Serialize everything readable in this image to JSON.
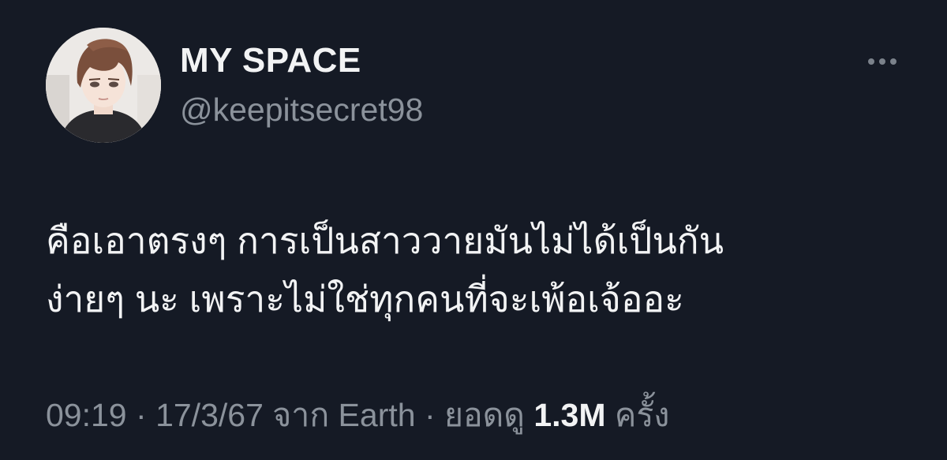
{
  "user": {
    "display_name": "MY SPACE",
    "handle": "@keepitsecret98",
    "avatar_icon": "anime-man-avatar"
  },
  "more_icon": "more-horizontal-icon",
  "tweet": {
    "lines": [
      "คือเอาตรงๆ การเป็นสาววายมันไม่ได้เป็นกัน",
      "ง่ายๆ นะ เพราะไม่ใช่ทุกคนที่จะเพ้อเจ้ออะ"
    ]
  },
  "meta": {
    "time": "09:19",
    "separator": "·",
    "date": "17/3/67",
    "source": "จาก Earth",
    "views_label": "ยอดดู",
    "views_count": "1.3M",
    "views_unit": "ครั้ง"
  },
  "colors": {
    "background": "#151a25",
    "primary_text": "#f2f3f4",
    "secondary_text": "#8b929b"
  }
}
